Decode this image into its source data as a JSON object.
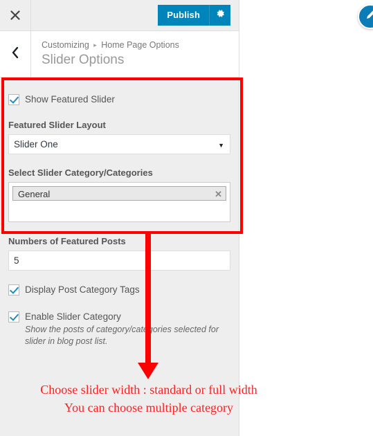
{
  "header": {
    "close_icon": "close-icon",
    "publish_label": "Publish",
    "gear_icon": "gear-icon"
  },
  "section": {
    "back_icon": "chevron-left-icon",
    "breadcrumb_root": "Customizing",
    "breadcrumb_separator": "▸",
    "breadcrumb_parent": "Home Page Options",
    "title": "Slider Options"
  },
  "controls": {
    "show_featured_slider": {
      "label": "Show Featured Slider",
      "checked": true
    },
    "featured_slider_layout": {
      "label": "Featured Slider Layout",
      "value": "Slider One",
      "options": [
        "Slider One"
      ],
      "caret_icon": "chevron-down-icon"
    },
    "slider_category": {
      "label": "Select Slider Category/Categories",
      "tags": [
        {
          "name": "General",
          "remove_icon": "close-icon",
          "remove_glyph": "✕"
        }
      ]
    },
    "featured_posts_count": {
      "label": "Numbers of Featured Posts",
      "value": "5"
    },
    "display_post_category_tags": {
      "label": "Display Post Category Tags",
      "checked": true
    },
    "enable_slider_category": {
      "label": "Enable Slider Category",
      "description": "Show the posts of category/categories selected for slider in blog post list.",
      "checked": true
    }
  },
  "annotation": {
    "line1": "Choose slider width : standard or full width",
    "line2": "You can choose multiple category",
    "color": "#ff0000"
  },
  "preview": {
    "edit_icon": "pencil-edit-icon"
  },
  "theme": {
    "accent": "#0085ba",
    "panel_bg": "#eeeeee",
    "annotation_red": "#ff0000"
  }
}
